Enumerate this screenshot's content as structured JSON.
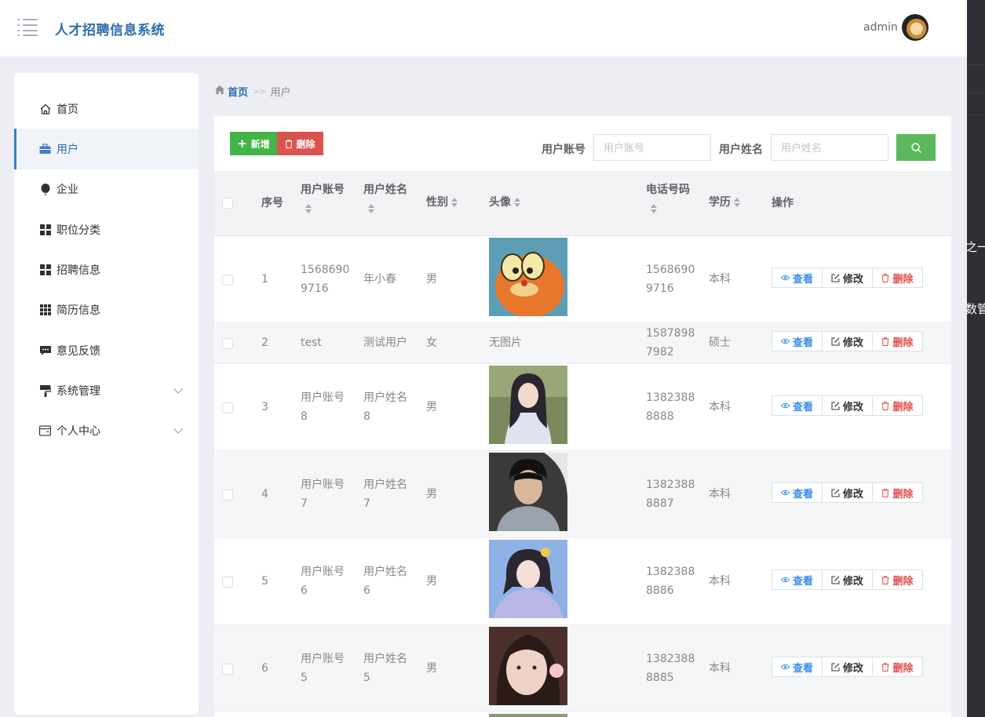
{
  "app": {
    "title": "人才招聘信息系统",
    "user": "admin"
  },
  "sidebar": {
    "items": [
      {
        "label": "首页",
        "icon": "home-icon"
      },
      {
        "label": "用户",
        "icon": "briefcase-icon"
      },
      {
        "label": "企业",
        "icon": "balloon-icon"
      },
      {
        "label": "职位分类",
        "icon": "grid-icon"
      },
      {
        "label": "招聘信息",
        "icon": "grid-icon"
      },
      {
        "label": "简历信息",
        "icon": "grid-dense-icon"
      },
      {
        "label": "意见反馈",
        "icon": "comment-icon"
      },
      {
        "label": "系统管理",
        "icon": "paint-roller-icon"
      },
      {
        "label": "个人中心",
        "icon": "card-icon"
      }
    ]
  },
  "breadcrumb": {
    "home": "首页",
    "sep": ">>",
    "current": "用户"
  },
  "toolbar": {
    "add_label": "新增",
    "delete_label": "删除"
  },
  "search": {
    "account_label": "用户账号",
    "account_placeholder": "用户账号",
    "name_label": "用户姓名",
    "name_placeholder": "用户姓名"
  },
  "table": {
    "headers": {
      "index": "序号",
      "account": "用户账号",
      "name": "用户姓名",
      "gender": "性别",
      "avatar": "头像",
      "phone": "电话号码",
      "education": "学历",
      "actions": "操作"
    },
    "action_labels": {
      "view": "查看",
      "edit": "修改",
      "delete": "删除"
    },
    "rows": [
      {
        "index": "1",
        "account_l1": "1568690",
        "account_l2": "9716",
        "name_l1": "年小春",
        "name_l2": "",
        "gender": "男",
        "avatar_text": "",
        "phone_l1": "1568690",
        "phone_l2": "9716",
        "education": "本科"
      },
      {
        "index": "2",
        "account_l1": "test",
        "account_l2": "",
        "name_l1": "测试用户",
        "name_l2": "",
        "gender": "女",
        "avatar_text": "无图片",
        "phone_l1": "1587898",
        "phone_l2": "7982",
        "education": "硕士"
      },
      {
        "index": "3",
        "account_l1": "用户账号",
        "account_l2": "8",
        "name_l1": "用户姓名",
        "name_l2": "8",
        "gender": "男",
        "avatar_text": "",
        "phone_l1": "1382388",
        "phone_l2": "8888",
        "education": "本科"
      },
      {
        "index": "4",
        "account_l1": "用户账号",
        "account_l2": "7",
        "name_l1": "用户姓名",
        "name_l2": "7",
        "gender": "男",
        "avatar_text": "",
        "phone_l1": "1382388",
        "phone_l2": "8887",
        "education": "本科"
      },
      {
        "index": "5",
        "account_l1": "用户账号",
        "account_l2": "6",
        "name_l1": "用户姓名",
        "name_l2": "6",
        "gender": "男",
        "avatar_text": "",
        "phone_l1": "1382388",
        "phone_l2": "8886",
        "education": "本科"
      },
      {
        "index": "6",
        "account_l1": "用户账号",
        "account_l2": "5",
        "name_l1": "用户姓名",
        "name_l2": "5",
        "gender": "男",
        "avatar_text": "",
        "phone_l1": "1382388",
        "phone_l2": "8885",
        "education": "本科"
      }
    ]
  },
  "right_panel": {
    "text1": "之一",
    "text2": "数管"
  },
  "colors": {
    "accent": "#2b6cb0",
    "add": "#43b449",
    "delete": "#d9534f",
    "search": "#5cb85c"
  }
}
